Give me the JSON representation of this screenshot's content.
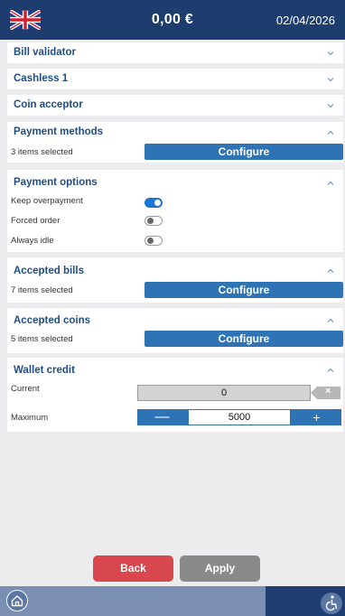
{
  "header": {
    "balance": "0,00 €",
    "date": "02/04/2026"
  },
  "sections": {
    "bill_validator": {
      "title": "Bill validator"
    },
    "cashless_1": {
      "title": "Cashless 1"
    },
    "coin_acceptor": {
      "title": "Coin acceptor"
    },
    "payment_methods": {
      "title": "Payment methods",
      "summary": "3 items selected",
      "button": "Configure"
    },
    "payment_options": {
      "title": "Payment options",
      "options": [
        {
          "label": "Keep overpayment",
          "enabled": true
        },
        {
          "label": "Forced order",
          "enabled": false
        },
        {
          "label": "Always idle",
          "enabled": false
        }
      ]
    },
    "accepted_bills": {
      "title": "Accepted bills",
      "summary": "7 items selected",
      "button": "Configure"
    },
    "accepted_coins": {
      "title": "Accepted coins",
      "summary": "5 items selected",
      "button": "Configure"
    },
    "wallet_credit": {
      "title": "Wallet credit",
      "current_label": "Current",
      "current_value": "0",
      "maximum_label": "Maximum",
      "maximum_value": "5000",
      "minus": "—",
      "plus": "+",
      "clear": "×"
    }
  },
  "footer": {
    "back_label": "Back",
    "apply_label": "Apply"
  },
  "icons": {
    "flag": "uk-flag-icon",
    "home": "home-icon",
    "accessibility": "accessibility-icon",
    "chevron": "chevron-icon"
  },
  "colors": {
    "header_bg": "#1d3d6e",
    "accent": "#2e74b5",
    "section_title": "#1f4d86",
    "back_button": "#d9474e",
    "apply_button": "#8a8a8a",
    "toggle_on": "#1a78d4"
  }
}
